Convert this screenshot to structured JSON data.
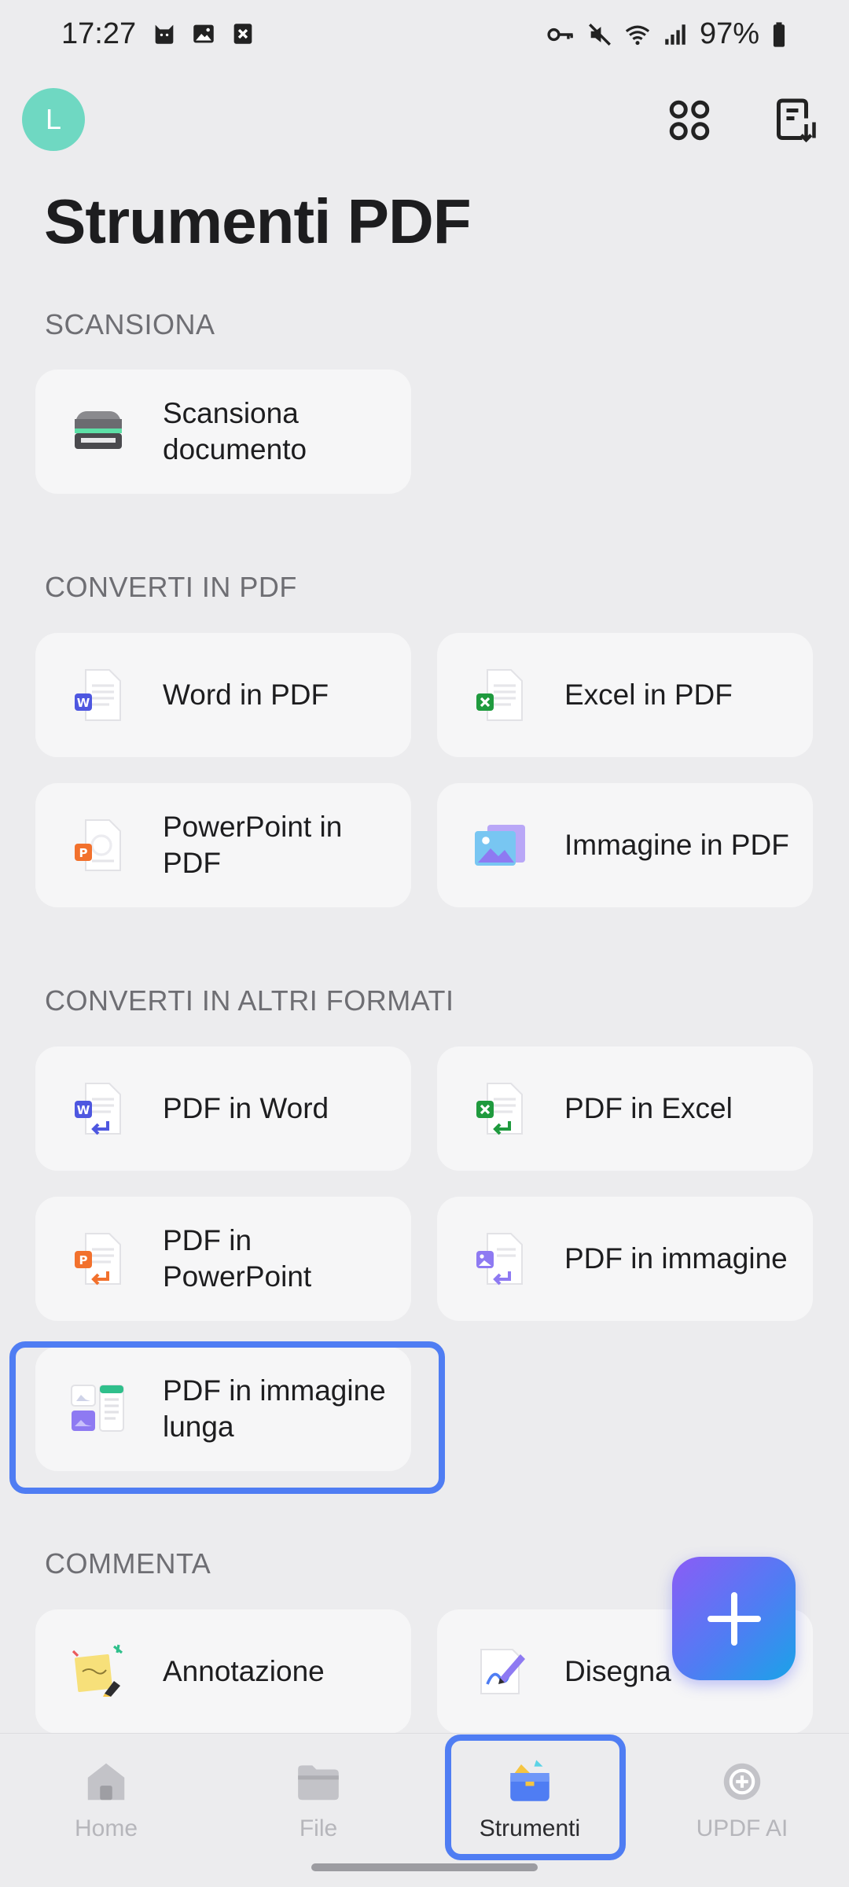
{
  "status_bar": {
    "time": "17:27",
    "battery": "97%"
  },
  "header": {
    "avatar_letter": "L",
    "title": "Strumenti PDF"
  },
  "sections": {
    "scan": {
      "header": "SCANSIONA",
      "items": [
        {
          "label": "Scansiona\ndocumento",
          "icon": "scanner-icon"
        }
      ]
    },
    "to_pdf": {
      "header": "CONVERTI IN PDF",
      "items": [
        {
          "label": "Word in PDF",
          "icon": "word-doc-icon"
        },
        {
          "label": "Excel in PDF",
          "icon": "excel-doc-icon"
        },
        {
          "label": "PowerPoint in\nPDF",
          "icon": "powerpoint-doc-icon"
        },
        {
          "label": "Immagine in PDF",
          "icon": "image-doc-icon"
        }
      ]
    },
    "other_formats": {
      "header": "CONVERTI IN ALTRI FORMATI",
      "items": [
        {
          "label": "PDF in Word",
          "icon": "pdf-to-word-icon"
        },
        {
          "label": "PDF in Excel",
          "icon": "pdf-to-excel-icon"
        },
        {
          "label": "PDF in\nPowerPoint",
          "icon": "pdf-to-powerpoint-icon"
        },
        {
          "label": "PDF in immagine",
          "icon": "pdf-to-image-icon"
        },
        {
          "label": "PDF in immagine\nlunga",
          "icon": "pdf-to-long-image-icon"
        }
      ]
    },
    "comment": {
      "header": "COMMENTA",
      "items": [
        {
          "label": "Annotazione",
          "icon": "sticky-note-icon"
        },
        {
          "label": "Disegna",
          "icon": "pen-draw-icon"
        }
      ]
    }
  },
  "bottom_nav": [
    {
      "label": "Home",
      "icon": "home-icon",
      "active": false
    },
    {
      "label": "File",
      "icon": "folder-icon",
      "active": false
    },
    {
      "label": "Strumenti",
      "icon": "toolbox-icon",
      "active": true
    },
    {
      "label": "UPDF AI",
      "icon": "ai-icon",
      "active": false
    }
  ],
  "colors": {
    "accent": "#4f7df3",
    "avatar": "#6fd8c2",
    "background": "#ececee",
    "card": "#f6f6f7"
  }
}
